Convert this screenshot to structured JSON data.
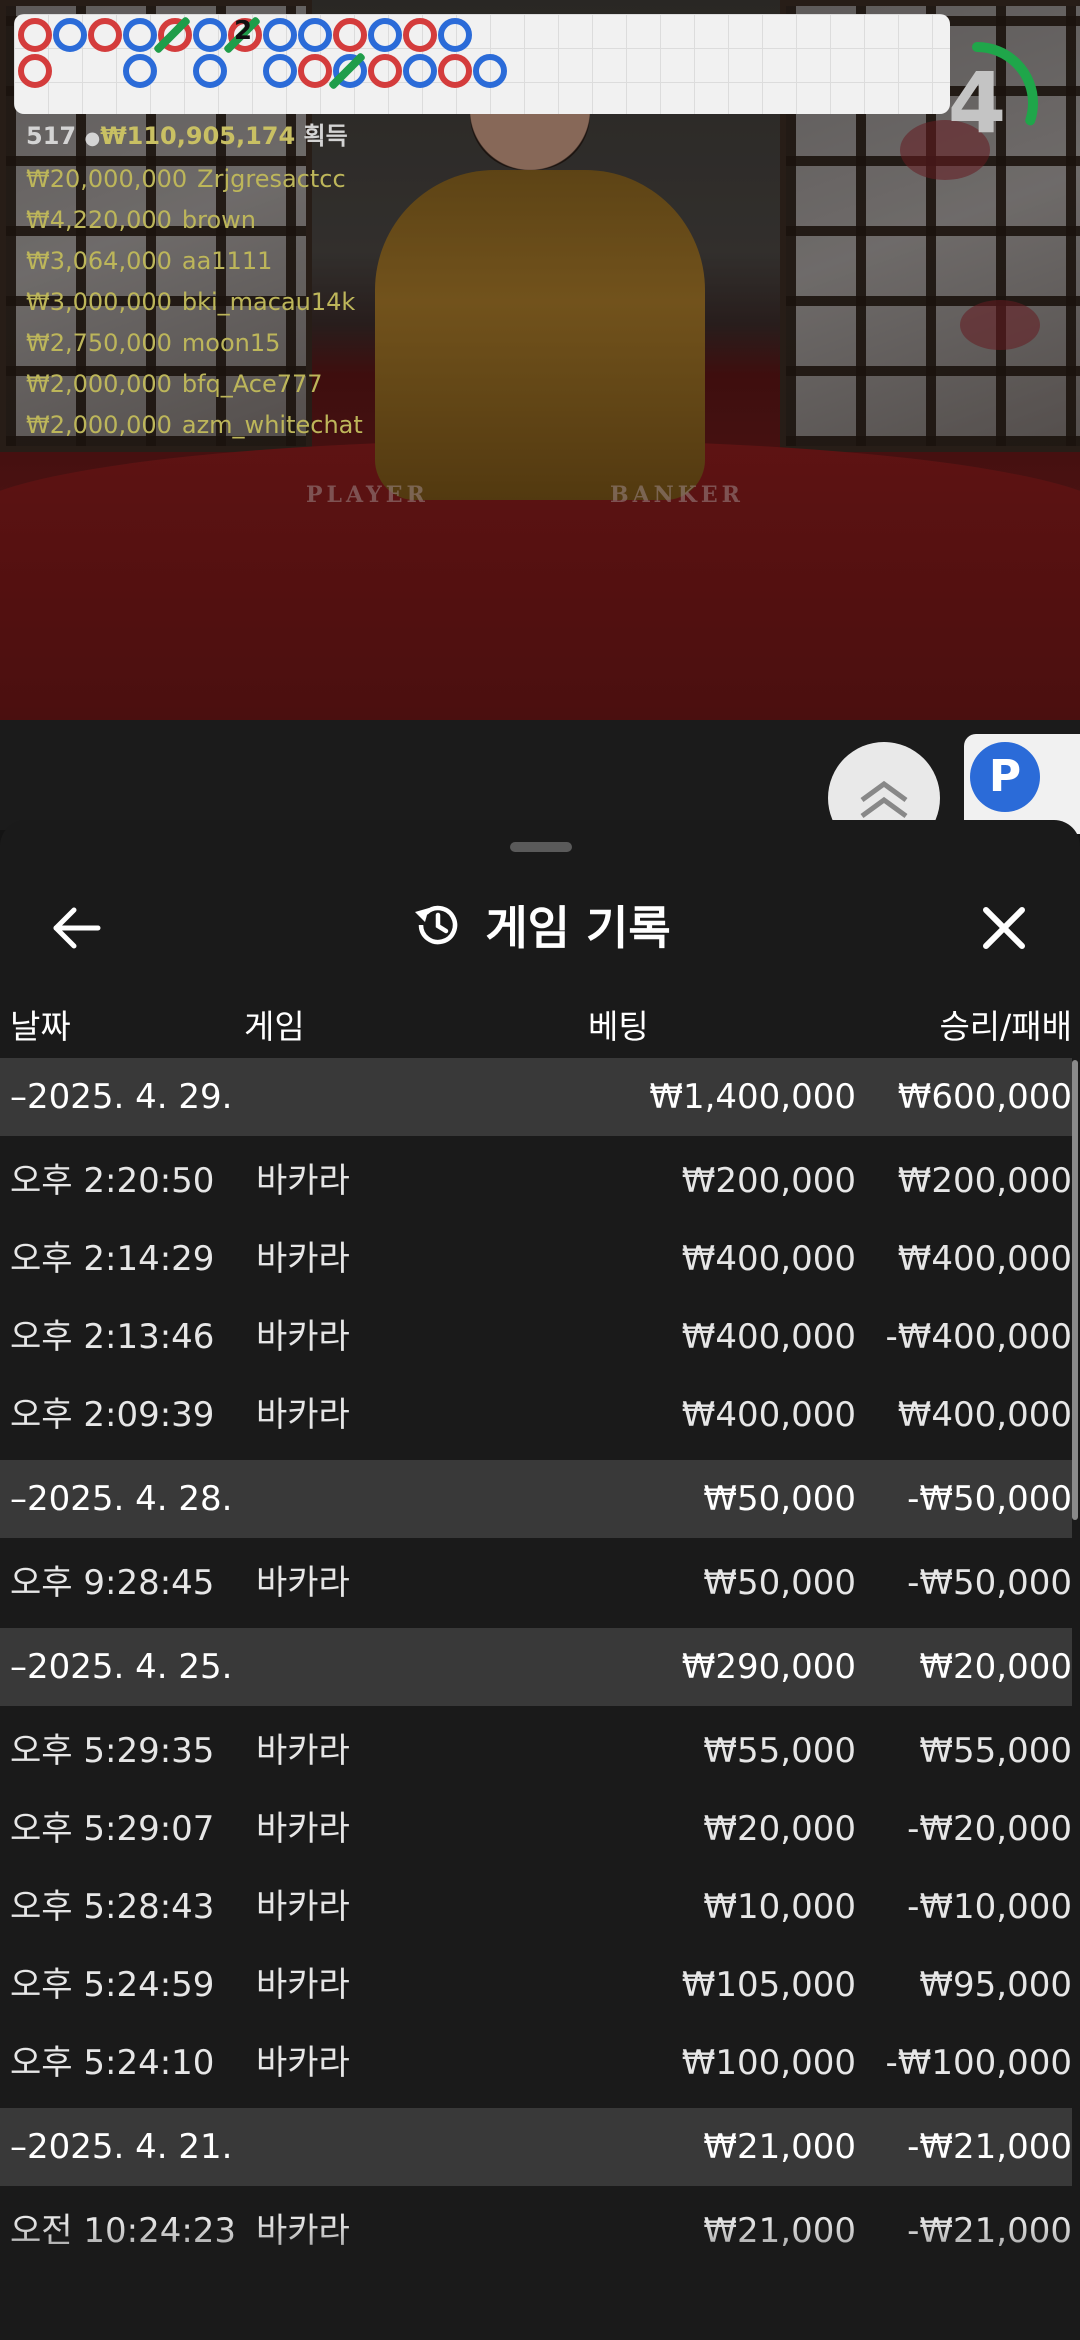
{
  "video": {
    "table_labels": {
      "player": "PLAYER",
      "banker": "BANKER"
    },
    "winners_header": {
      "count": "517",
      "amount": "₩110,905,174",
      "suffix": "획득"
    },
    "winners": [
      {
        "amount": "₩20,000,000",
        "name": "Zrjgresactcc"
      },
      {
        "amount": "₩4,220,000",
        "name": "brown"
      },
      {
        "amount": "₩3,064,000",
        "name": "aa1111"
      },
      {
        "amount": "₩3,000,000",
        "name": "bki_macau14k"
      },
      {
        "amount": "₩2,750,000",
        "name": "moon15"
      },
      {
        "amount": "₩2,000,000",
        "name": "bfq_Ace777"
      },
      {
        "amount": "₩2,000,000",
        "name": "azm_whitechat"
      }
    ],
    "countdown": "4",
    "countdown_progress": 0.3,
    "timer_color": "#1fa64a"
  },
  "roadmap": {
    "badge": "P",
    "slash_label": "2",
    "player_color": "#2b6bd8",
    "banker_color": "#d43c3c"
  },
  "sheet": {
    "title": "게임 기록",
    "title_icon": "history-icon",
    "back_icon": "arrow-left-icon",
    "close_icon": "close-icon",
    "columns": {
      "date": "날짜",
      "game": "게임",
      "bet": "베팅",
      "result": "승리/패배"
    },
    "groups": [
      {
        "date": "–2025. 4. 29.",
        "bet": "₩1,400,000",
        "result": "₩600,000",
        "rows": [
          {
            "time": "오후 2:20:50",
            "game": "바카라",
            "bet": "₩200,000",
            "result": "₩200,000"
          },
          {
            "time": "오후 2:14:29",
            "game": "바카라",
            "bet": "₩400,000",
            "result": "₩400,000"
          },
          {
            "time": "오후 2:13:46",
            "game": "바카라",
            "bet": "₩400,000",
            "result": "-₩400,000"
          },
          {
            "time": "오후 2:09:39",
            "game": "바카라",
            "bet": "₩400,000",
            "result": "₩400,000"
          }
        ]
      },
      {
        "date": "–2025. 4. 28.",
        "bet": "₩50,000",
        "result": "-₩50,000",
        "rows": [
          {
            "time": "오후 9:28:45",
            "game": "바카라",
            "bet": "₩50,000",
            "result": "-₩50,000"
          }
        ]
      },
      {
        "date": "–2025. 4. 25.",
        "bet": "₩290,000",
        "result": "₩20,000",
        "rows": [
          {
            "time": "오후 5:29:35",
            "game": "바카라",
            "bet": "₩55,000",
            "result": "₩55,000"
          },
          {
            "time": "오후 5:29:07",
            "game": "바카라",
            "bet": "₩20,000",
            "result": "-₩20,000"
          },
          {
            "time": "오후 5:28:43",
            "game": "바카라",
            "bet": "₩10,000",
            "result": "-₩10,000"
          },
          {
            "time": "오후 5:24:59",
            "game": "바카라",
            "bet": "₩105,000",
            "result": "₩95,000"
          },
          {
            "time": "오후 5:24:10",
            "game": "바카라",
            "bet": "₩100,000",
            "result": "-₩100,000"
          }
        ]
      },
      {
        "date": "–2025. 4. 21.",
        "bet": "₩21,000",
        "result": "-₩21,000",
        "rows": [
          {
            "time": "오전 10:24:23",
            "game": "바카라",
            "bet": "₩21,000",
            "result": "-₩21,000"
          }
        ]
      }
    ]
  }
}
